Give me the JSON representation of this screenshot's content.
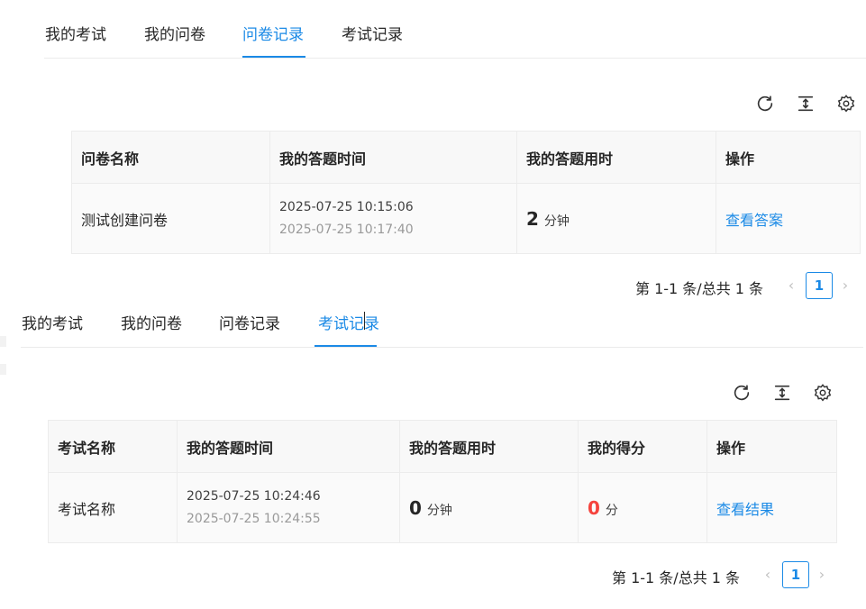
{
  "tabs": [
    "我的考试",
    "我的问卷",
    "问卷记录",
    "考试记录"
  ],
  "survey_panel": {
    "active_tab": "问卷记录",
    "columns": [
      "问卷名称",
      "我的答题时间",
      "我的答题用时",
      "操作"
    ],
    "row": {
      "name": "测试创建问卷",
      "start_time": "2025-07-25 10:15:06",
      "end_time": "2025-07-25 10:17:40",
      "duration": "2",
      "duration_unit": "分钟",
      "action": "查看答案"
    },
    "pagination": {
      "total_text": "第 1-1 条/总共 1 条",
      "current_page": "1"
    }
  },
  "exam_panel": {
    "active_tab": "考试记录",
    "columns": [
      "考试名称",
      "我的答题时间",
      "我的答题用时",
      "我的得分",
      "操作"
    ],
    "row": {
      "name": "考试名称",
      "start_time": "2025-07-25 10:24:46",
      "end_time": "2025-07-25 10:24:55",
      "duration": "0",
      "duration_unit": "分钟",
      "score": "0",
      "score_unit": "分",
      "action": "查看结果"
    },
    "pagination": {
      "total_text": "第 1-1 条/总共 1 条",
      "current_page": "1"
    }
  },
  "toolbar_icons": [
    "reload-icon",
    "column-height-icon",
    "setting-icon"
  ],
  "colors": {
    "accent": "#1b8ae6",
    "score": "#f5433d",
    "header_bg": "#f8f8f8",
    "border": "#ececec"
  }
}
